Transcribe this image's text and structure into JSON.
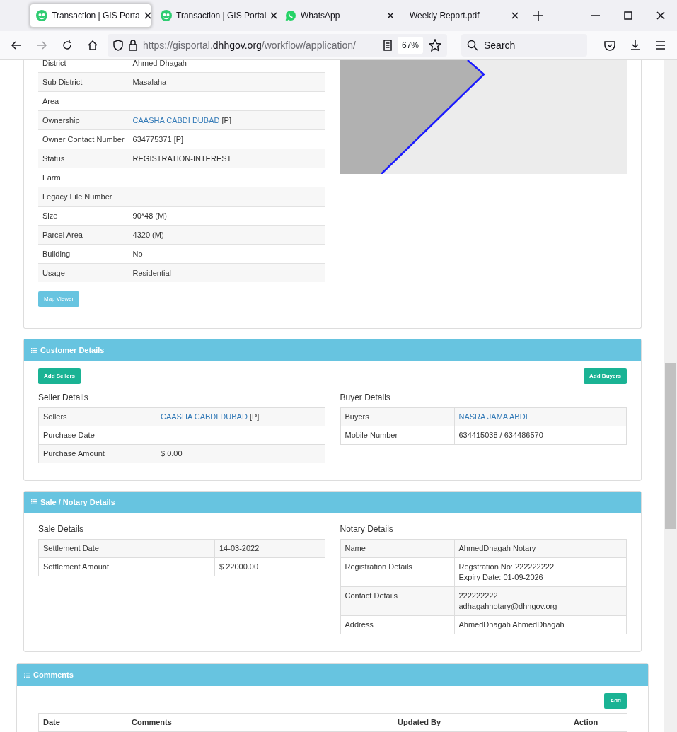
{
  "browser": {
    "tabs": [
      {
        "title": "Transaction | GIS Porta",
        "kind": "site",
        "selected": true
      },
      {
        "title": "Transaction | GIS Portal",
        "kind": "site",
        "selected": false
      },
      {
        "title": "WhatsApp",
        "kind": "chat",
        "selected": false
      },
      {
        "title": "Weekly Report.pdf",
        "kind": "file",
        "selected": false
      }
    ],
    "address": {
      "scheme_host": "https://gisportal.",
      "domain": "dhhgov.org",
      "path": "/workflow/application/"
    },
    "zoom": "67%",
    "search": {
      "placeholder": "Search"
    }
  },
  "parcel": {
    "rows": [
      {
        "label": "District",
        "value": "Ahmed Dhagah"
      },
      {
        "label": "Sub District",
        "value": "Masalaha"
      },
      {
        "label": "Area",
        "value": ""
      },
      {
        "label": "Ownership",
        "link": "CAASHA CABDI DUBAD",
        "value": "[P]"
      },
      {
        "label": "Owner Contact Number",
        "value": "634775371 [P]"
      },
      {
        "label": "Status",
        "value": "REGISTRATION-INTEREST"
      },
      {
        "label": "Farm",
        "value": ""
      },
      {
        "label": "Legacy File Number",
        "value": ""
      },
      {
        "label": "Size",
        "value": "90*48 (M)"
      },
      {
        "label": "Parcel Area",
        "value": "4320 (M)"
      },
      {
        "label": "Building",
        "value": "No"
      },
      {
        "label": "Usage",
        "value": "Residential"
      }
    ],
    "button": "Map Viewer"
  },
  "customer": {
    "title": "Customer Details",
    "add_sellers": "Add Sellers",
    "add_buyers": "Add Buyers",
    "seller": {
      "heading": "Seller Details",
      "rows": [
        {
          "label": "Sellers",
          "link": "CAASHA CABDI DUBAD",
          "value": "[P]"
        },
        {
          "label": "Purchase Date",
          "value": ""
        },
        {
          "label": "Purchase Amount",
          "value": "$ 0.00"
        }
      ]
    },
    "buyer": {
      "heading": "Buyer Details",
      "rows": [
        {
          "label": "Buyers",
          "link": "NASRA JAMA ABDI",
          "value": ""
        },
        {
          "label": "Mobile Number",
          "value": "634415038 / 634486570"
        }
      ]
    }
  },
  "sale": {
    "title": "Sale / Notary Details",
    "sale": {
      "heading": "Sale Details",
      "rows": [
        {
          "label": "Settlement Date",
          "value": "14-03-2022"
        },
        {
          "label": "Settlement Amount",
          "value": "$ 22000.00"
        }
      ]
    },
    "notary": {
      "heading": "Notary Details",
      "rows": [
        {
          "label": "Name",
          "lines": [
            "AhmedDhagah Notary"
          ]
        },
        {
          "label": "Registration Details",
          "lines": [
            "Regstration No: 222222222",
            "Expiry Date: 01-09-2026"
          ]
        },
        {
          "label": "Contact Details",
          "lines": [
            "222222222",
            "adhagahnotary@dhhgov.org"
          ]
        },
        {
          "label": "Address",
          "lines": [
            "AhmedDhagah AhmedDhagah"
          ]
        }
      ]
    }
  },
  "comments": {
    "title": "Comments",
    "add": "Add",
    "columns": [
      "Date",
      "Comments",
      "Updated By",
      "Action"
    ]
  }
}
